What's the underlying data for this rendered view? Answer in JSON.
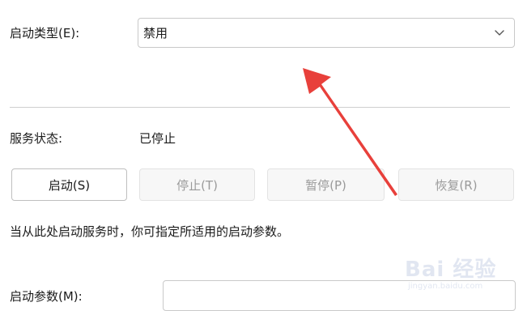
{
  "startup_type": {
    "label": "启动类型(E):",
    "selected": "禁用"
  },
  "service_status": {
    "label": "服务状态:",
    "value": "已停止"
  },
  "buttons": {
    "start": "启动(S)",
    "stop": "停止(T)",
    "pause": "暂停(P)",
    "resume": "恢复(R)"
  },
  "hint_text": "当从此处启动服务时，你可指定所适用的启动参数。",
  "start_params": {
    "label": "启动参数(M):",
    "value": ""
  },
  "annotation": {
    "arrow_color": "#e8403b"
  },
  "watermark": {
    "brand": "Bai 经验",
    "site": "jingyan.baidu.com"
  },
  "icons": {
    "dropdown": "chevron-down-icon",
    "arrow": "red-arrow-annotation"
  }
}
